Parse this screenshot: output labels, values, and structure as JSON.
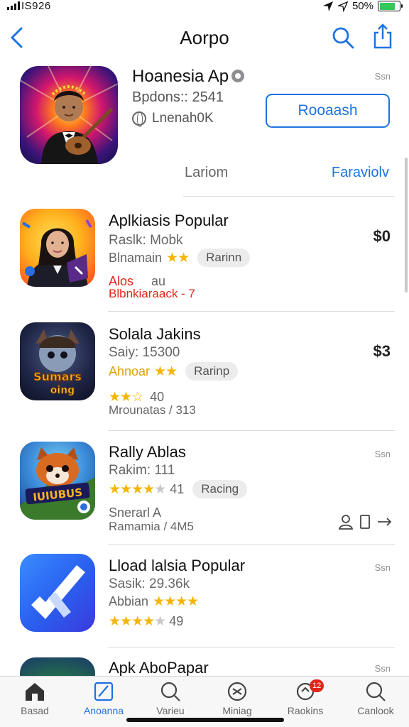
{
  "status_bar": {
    "carrier": "IS926",
    "battery": "50%",
    "colors": {
      "battery": "#34c759"
    }
  },
  "nav": {
    "title": "Aorpo",
    "icons": [
      "back-chevron-icon",
      "search-icon",
      "share-icon"
    ]
  },
  "hero": {
    "title": "Hoanesia Ap",
    "subtitle": "Bpdons:: 2541",
    "developer": "Lnenah0K",
    "size": "Ssn",
    "button_label": "Rooaash",
    "tab_left": "Lariom",
    "tab_right": "Faraviolv"
  },
  "apps": [
    {
      "name": "Aplkiasis Popular",
      "sub": "Raslk: Mobk",
      "line3_text": "Blnamain",
      "stars": "★★",
      "chip": "Rarinn",
      "line4_a": "Alos",
      "line4_b": "au",
      "line5": "Blbnkiaraack - 7",
      "price": "$0"
    },
    {
      "name": "Solala Jakins",
      "sub": "Saiy: 15300",
      "line3_text": "Ahnoar",
      "stars": "★★",
      "chip": "Rarinp",
      "line4_stars": "★★☆",
      "line4_b": "40",
      "line5": "Mrounatas / 313",
      "price": "$3"
    },
    {
      "name": "Rally Ablas",
      "sub": "Rakim: 111",
      "stars_full": "★★★★",
      "stars_off": "★",
      "line3_text": "41",
      "chip": "Racing",
      "line4_a": "Snerarl A",
      "line5": "Ramamia / 4M5",
      "size": "Ssn"
    },
    {
      "name": "Lload lalsia Popular",
      "sub": "Sasik: 29.36k",
      "line3_text": "Abbian",
      "stars": "★★★★",
      "stars_full": "★★★★",
      "stars_off": "★",
      "line4_b": "49",
      "size": "Ssn"
    },
    {
      "name": "Apk AboPapar",
      "size": "Ssn"
    }
  ],
  "tabs": [
    {
      "label": "Basad",
      "icon": "home-icon"
    },
    {
      "label": "Anoanna",
      "icon": "apps-icon"
    },
    {
      "label": "Varieu",
      "icon": "search-icon"
    },
    {
      "label": "Miniag",
      "icon": "games-icon"
    },
    {
      "label": "Raokins",
      "icon": "ranking-icon",
      "badge": "12"
    },
    {
      "label": "Canlook",
      "icon": "search-icon"
    }
  ],
  "colors": {
    "accent": "#1e73e0",
    "star": "#f4b400",
    "badge": "#e0261b"
  }
}
